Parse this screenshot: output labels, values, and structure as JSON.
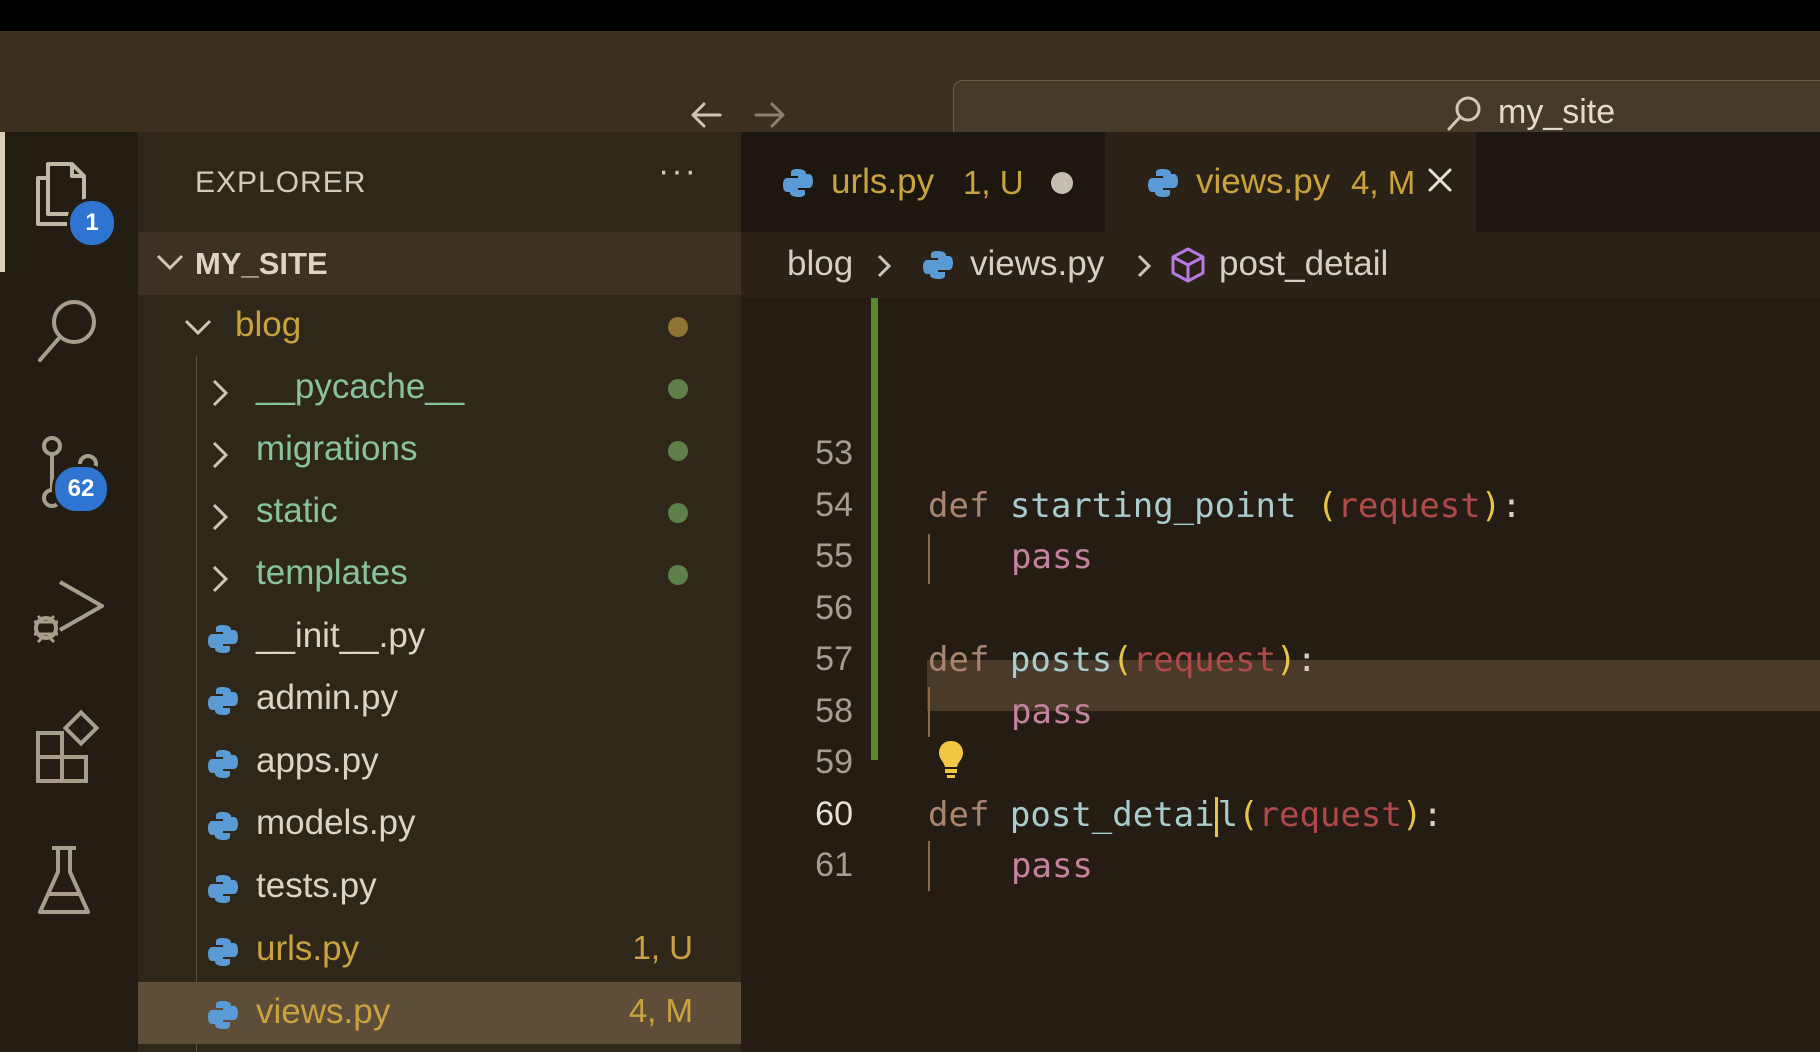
{
  "window": {
    "search_text": "my_site"
  },
  "activity_bar": {
    "explorer_badge": "1",
    "source_control_badge": "62"
  },
  "sidebar": {
    "header": "EXPLORER",
    "more": "···",
    "section": "MY_SITE",
    "tree": [
      {
        "label": "blog",
        "kind": "folder-open",
        "dot": "#8f7535"
      },
      {
        "label": "__pycache__",
        "kind": "folder",
        "dot": "#5f7f4a"
      },
      {
        "label": "migrations",
        "kind": "folder",
        "dot": "#5f7f4a"
      },
      {
        "label": "static",
        "kind": "folder",
        "dot": "#5f7f4a"
      },
      {
        "label": "templates",
        "kind": "folder",
        "dot": "#5f7f4a"
      },
      {
        "label": "__init__.py",
        "kind": "file"
      },
      {
        "label": "admin.py",
        "kind": "file"
      },
      {
        "label": "apps.py",
        "kind": "file"
      },
      {
        "label": "models.py",
        "kind": "file"
      },
      {
        "label": "tests.py",
        "kind": "file"
      },
      {
        "label": "urls.py",
        "kind": "file",
        "status": "1, U"
      },
      {
        "label": "views.py",
        "kind": "file",
        "status": "4, M",
        "selected": true
      }
    ]
  },
  "tabs": [
    {
      "label": "urls.py",
      "status": "1, U",
      "active": false
    },
    {
      "label": "views.py",
      "status": "4, M",
      "active": true
    }
  ],
  "breadcrumbs": {
    "folder": "blog",
    "file": "views.py",
    "symbol": "post_detail"
  },
  "code": {
    "current_line": 60,
    "lines": [
      {
        "n": "53"
      },
      {
        "n": "54",
        "kw": "def",
        "fn": "starting_point ",
        "param": "request"
      },
      {
        "n": "55",
        "body": "pass"
      },
      {
        "n": "56"
      },
      {
        "n": "57",
        "kw": "def",
        "fn": "posts",
        "param": "request"
      },
      {
        "n": "58",
        "body": "pass"
      },
      {
        "n": "59"
      },
      {
        "n": "60",
        "kw": "def",
        "fn_a": "post_detai",
        "fn_b": "l",
        "param": "request"
      },
      {
        "n": "61",
        "body": "pass"
      }
    ]
  },
  "colors": {
    "python_blue": "#5a9bd5",
    "untracked_yellow": "#c9a33e",
    "folder_green": "#88c49a",
    "accent_badge": "#2f74d0"
  }
}
